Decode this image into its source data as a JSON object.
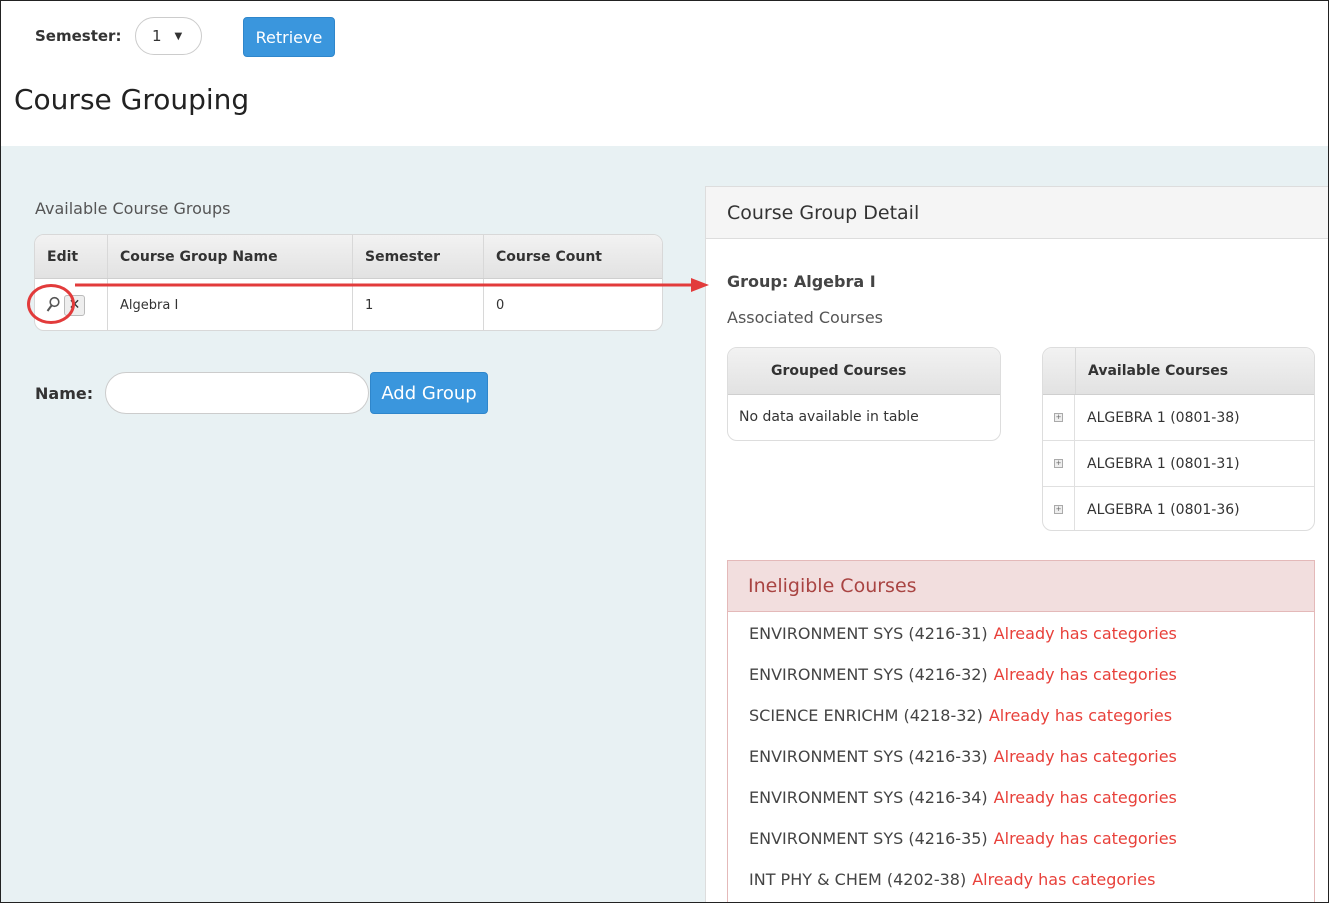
{
  "toolbar": {
    "semester_label": "Semester:",
    "semester_value": "1",
    "retrieve_label": "Retrieve"
  },
  "page_title": "Course Grouping",
  "available_groups": {
    "title": "Available Course Groups",
    "columns": [
      "Edit",
      "Course Group Name",
      "Semester",
      "Course Count"
    ],
    "rows": [
      {
        "name": "Algebra I",
        "semester": "1",
        "count": "0"
      }
    ]
  },
  "add_group": {
    "name_label": "Name:",
    "name_value": "",
    "button_label": "Add Group"
  },
  "detail": {
    "header": "Course Group Detail",
    "group_line": "Group: Algebra I",
    "associated_label": "Associated Courses",
    "grouped": {
      "header": "Grouped Courses",
      "empty_text": "No data available in table"
    },
    "available": {
      "header": "Available Courses",
      "items": [
        "ALGEBRA 1 (0801-38)",
        "ALGEBRA 1 (0801-31)",
        "ALGEBRA 1 (0801-36)"
      ]
    },
    "ineligible": {
      "header": "Ineligible Courses",
      "items": [
        {
          "course": "ENVIRONMENT SYS (4216-31)",
          "reason": "Already has categories"
        },
        {
          "course": "ENVIRONMENT SYS (4216-32)",
          "reason": "Already has categories"
        },
        {
          "course": "SCIENCE ENRICHM (4218-32)",
          "reason": "Already has categories"
        },
        {
          "course": "ENVIRONMENT SYS (4216-33)",
          "reason": "Already has categories"
        },
        {
          "course": "ENVIRONMENT SYS (4216-34)",
          "reason": "Already has categories"
        },
        {
          "course": "ENVIRONMENT SYS (4216-35)",
          "reason": "Already has categories"
        },
        {
          "course": "INT PHY & CHEM (4202-38)",
          "reason": "Already has categories"
        }
      ]
    }
  },
  "colors": {
    "accent_blue": "#3a96dd",
    "content_bg": "#e8f1f3",
    "annotation_red": "#e23b3b",
    "warning_text": "#e8403a",
    "danger_header_bg": "#f2dede"
  }
}
